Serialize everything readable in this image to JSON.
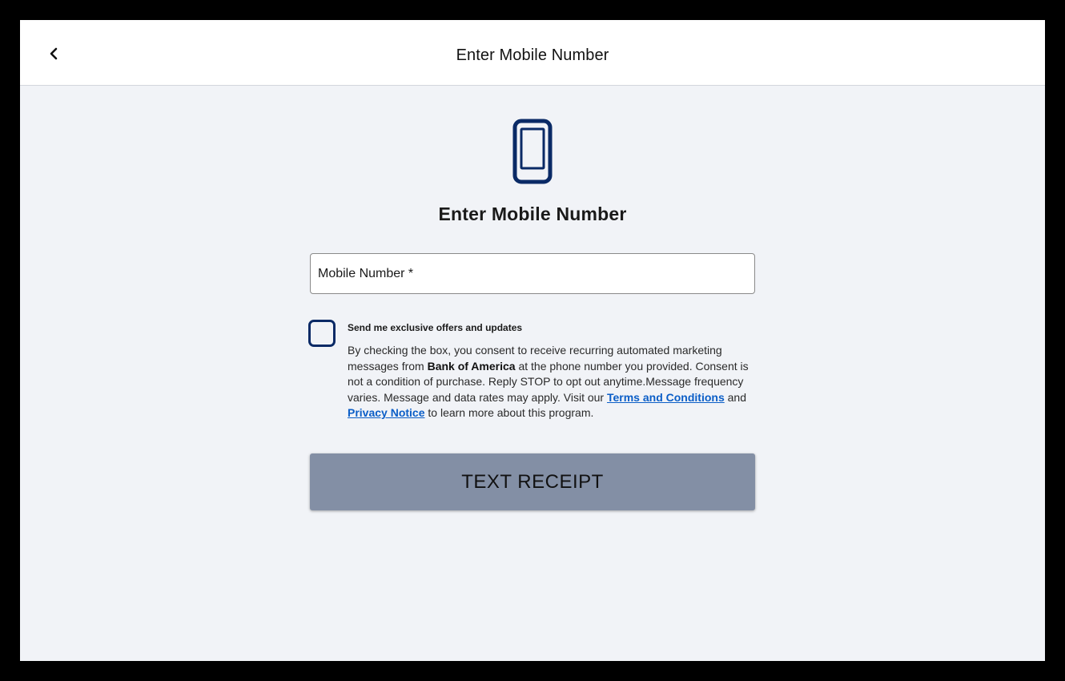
{
  "header": {
    "title": "Enter Mobile Number",
    "back_icon": "chevron-left-icon"
  },
  "main": {
    "icon": "smartphone-icon",
    "heading": "Enter Mobile Number",
    "mobile_input": {
      "placeholder": "Mobile Number *",
      "value": ""
    },
    "consent": {
      "checked": false,
      "label": "Send me exclusive offers and updates",
      "text_part1": "By checking the box, you consent to receive recurring automated marketing messages from ",
      "brand": "Bank of America",
      "text_part2": " at the phone number you provided. Consent is not a condition of purchase. Reply STOP to opt out anytime.Message frequency varies. Message and data rates may apply. Visit our ",
      "terms_link": "Terms and Conditions",
      "text_and": " and ",
      "privacy_link": "Privacy Notice",
      "text_part3": " to learn more about this program."
    },
    "submit_label": "TEXT RECEIPT"
  },
  "colors": {
    "accent": "#0a2a66",
    "link": "#0b5ec7",
    "button_disabled": "#838fa5",
    "background": "#f1f3f7"
  }
}
